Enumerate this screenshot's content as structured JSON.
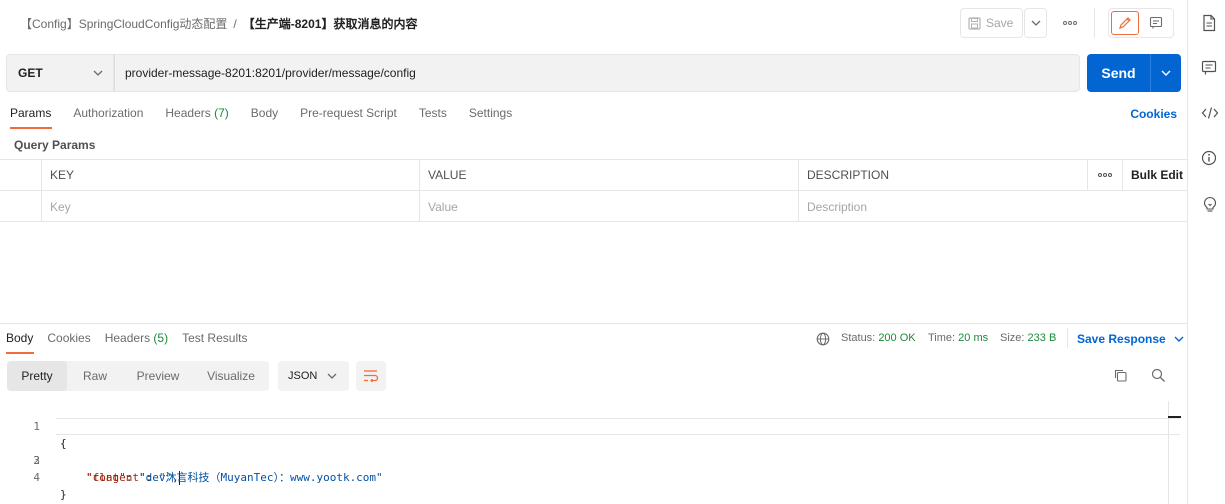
{
  "header": {
    "breadcrumb_parent": "【Config】SpringCloudConfig动态配置",
    "breadcrumb_sep": "/",
    "breadcrumb_current": "【生产端-8201】获取消息的内容",
    "save_label": "Save"
  },
  "request": {
    "method": "GET",
    "url": "provider-message-8201:8201/provider/message/config",
    "send_label": "Send"
  },
  "request_tabs": [
    {
      "label": "Params",
      "count": ""
    },
    {
      "label": "Authorization",
      "count": ""
    },
    {
      "label": "Headers",
      "count": "(7)"
    },
    {
      "label": "Body",
      "count": ""
    },
    {
      "label": "Pre-request Script",
      "count": ""
    },
    {
      "label": "Tests",
      "count": ""
    },
    {
      "label": "Settings",
      "count": ""
    }
  ],
  "cookies_link": "Cookies",
  "query_params_title": "Query Params",
  "params_table": {
    "headers": {
      "key": "KEY",
      "value": "VALUE",
      "description": "DESCRIPTION",
      "bulk_edit": "Bulk Edit"
    },
    "placeholders": {
      "key": "Key",
      "value": "Value",
      "description": "Description"
    }
  },
  "response_tabs": [
    {
      "label": "Body",
      "count": ""
    },
    {
      "label": "Cookies",
      "count": ""
    },
    {
      "label": "Headers",
      "count": "(5)"
    },
    {
      "label": "Test Results",
      "count": ""
    }
  ],
  "response_status": {
    "status_label": "Status:",
    "status_value": "200 OK",
    "time_label": "Time:",
    "time_value": "20 ms",
    "size_label": "Size:",
    "size_value": "233 B",
    "save_response": "Save Response"
  },
  "body_views": [
    "Pretty",
    "Raw",
    "Preview",
    "Visualize"
  ],
  "body_format": "JSON",
  "code_lines": [
    {
      "num": "1",
      "text": "{"
    },
    {
      "num": "2",
      "key": "\"flag\"",
      "value": "\"dev\"",
      "trail": ","
    },
    {
      "num": "3",
      "key": "\"content\"",
      "value": "\"沐言科技（MuyanTec）：www.yootk.com\"",
      "trail": ""
    },
    {
      "num": "4",
      "text": "}"
    }
  ],
  "colors": {
    "accent": "#f26b3a",
    "primary": "#0265d2",
    "success": "#1b8a3a"
  }
}
